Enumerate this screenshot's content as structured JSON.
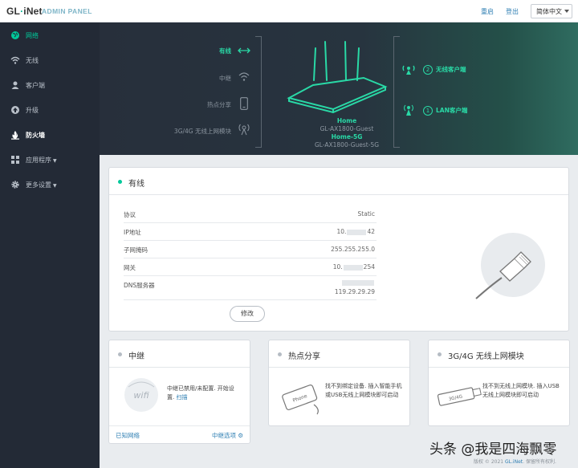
{
  "header": {
    "logo_brand": "GL",
    "logo_dot": "·",
    "logo_rest": "iNet",
    "admin_label": "ADMIN PANEL",
    "reboot": "重启",
    "logout": "登出",
    "language": "简体中文"
  },
  "sidebar": {
    "items": [
      {
        "label": "网络",
        "icon": "globe-icon"
      },
      {
        "label": "无线",
        "icon": "wifi-icon"
      },
      {
        "label": "客户端",
        "icon": "user-icon"
      },
      {
        "label": "升级",
        "icon": "upgrade-icon"
      },
      {
        "label": "防火墙",
        "icon": "firewall-icon"
      },
      {
        "label": "应用程序",
        "icon": "apps-icon"
      },
      {
        "label": "更多设置",
        "icon": "gear-icon"
      }
    ]
  },
  "banner": {
    "connections": [
      {
        "label": "有线",
        "icon": "ethernet-arrows-icon",
        "active": true
      },
      {
        "label": "中继",
        "icon": "wifi-icon",
        "active": false
      },
      {
        "label": "热点分享",
        "icon": "phone-icon",
        "active": false
      },
      {
        "label": "3G/4G 无线上网模块",
        "icon": "antenna-icon",
        "active": false
      }
    ],
    "ssid_2g": "Home",
    "guest_2g": "GL-AX1800-Guest",
    "ssid_5g": "Home-5G",
    "guest_5g": "GL-AX1800-Guest-5G",
    "wireless_clients_count": "2",
    "wireless_clients_label": "无线客户端",
    "lan_clients_count": "1",
    "lan_clients_label": "LAN客户端"
  },
  "wired_card": {
    "title": "有线",
    "rows": [
      {
        "key": "协议",
        "value": "Static"
      },
      {
        "key": "IP地址",
        "prefix": "10.",
        "suffix": "42"
      },
      {
        "key": "子网掩码",
        "value": "255.255.255.0"
      },
      {
        "key": "网关",
        "prefix": "10.",
        "suffix": "254"
      },
      {
        "key": "DNS服务器",
        "value": "119.29.29.29"
      }
    ],
    "modify_button": "修改"
  },
  "repeater_card": {
    "title": "中继",
    "status_text": "中继已禁用/未配置. 开始设置.",
    "scan_link": "扫描",
    "known_networks": "已知网络",
    "repeater_options": "中继选项"
  },
  "tethering_card": {
    "title": "热点分享",
    "text": "找不到绑定设备. 插入智能手机或USB无线上网模块即可启动",
    "device_label": "Phone"
  },
  "modem_card": {
    "title": "3G/4G 无线上网模块",
    "text": "找不到无线上网模块. 插入USB无线上网模块即可启动",
    "device_label": "3G/4G"
  },
  "footer": {
    "copyright_prefix": "版权 © 2021",
    "brand_link": "GL.iNet",
    "rights": ". 保留所有权利."
  },
  "watermark": "头条 @我是四海飘零",
  "colors": {
    "accent": "#00c99a",
    "sidebar_bg": "#232a36",
    "link": "#2f7fb3"
  }
}
